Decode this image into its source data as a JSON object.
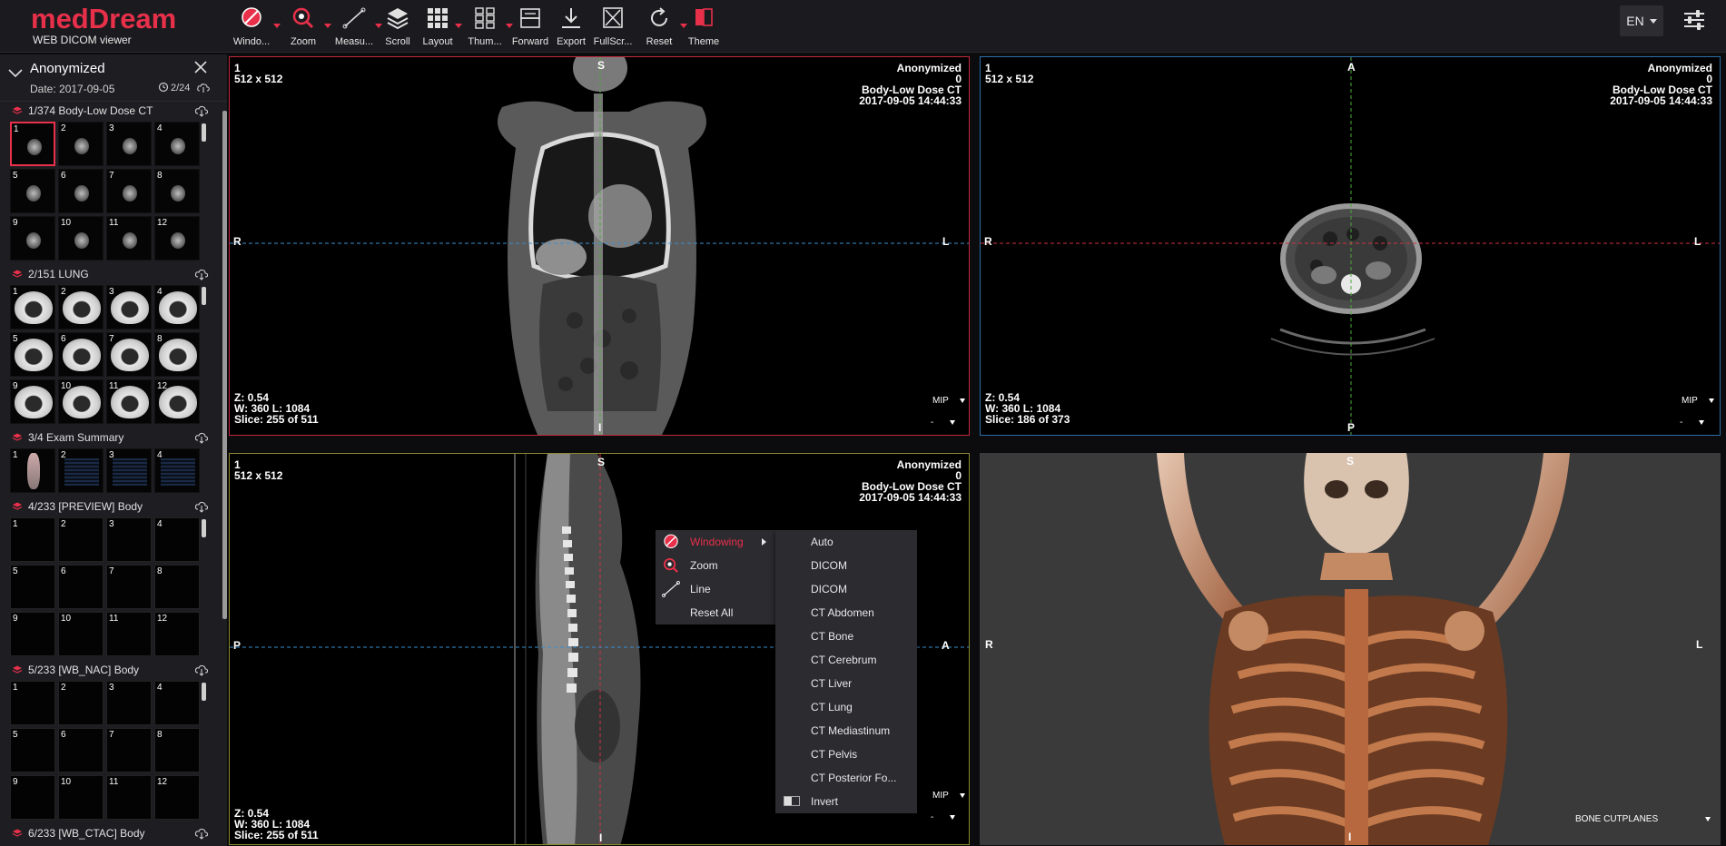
{
  "brand": {
    "logo": "medDream",
    "subtitle": "WEB DICOM viewer",
    "accent": "#e8304a"
  },
  "toolbar": [
    {
      "label": "Windo...",
      "icon": "windowing-icon",
      "caret": true
    },
    {
      "label": "Zoom",
      "icon": "zoom-icon",
      "caret": true
    },
    {
      "label": "Measu...",
      "icon": "measure-icon",
      "caret": true
    },
    {
      "label": "Scroll",
      "icon": "scroll-icon",
      "caret": false
    },
    {
      "label": "Layout",
      "icon": "layout-icon",
      "caret": true
    },
    {
      "label": "Thum...",
      "icon": "thumbnails-icon",
      "caret": true
    },
    {
      "label": "Forward",
      "icon": "forward-icon",
      "caret": false
    },
    {
      "label": "Export",
      "icon": "export-icon",
      "caret": false
    },
    {
      "label": "FullScr...",
      "icon": "fullscreen-icon",
      "caret": false
    },
    {
      "label": "Reset",
      "icon": "reset-icon",
      "caret": true
    },
    {
      "label": "Theme",
      "icon": "theme-icon",
      "caret": false
    }
  ],
  "language": "EN",
  "patient": {
    "name": "Anonymized",
    "date": "Date:  2017-09-05",
    "study_count": "2/24"
  },
  "series": [
    {
      "label": "1/374   Body-Low Dose CT",
      "kind": "ct",
      "thumbs": [
        "1",
        "2",
        "3",
        "4",
        "5",
        "6",
        "7",
        "8",
        "9",
        "10",
        "11",
        "12"
      ]
    },
    {
      "label": "2/151   LUNG",
      "kind": "lung",
      "thumbs": [
        "1",
        "2",
        "3",
        "4",
        "5",
        "6",
        "7",
        "8",
        "9",
        "10",
        "11",
        "12"
      ]
    },
    {
      "label": "3/4   Exam Summary",
      "kind": "summary",
      "thumbs": [
        "1",
        "2",
        "3",
        "4"
      ]
    },
    {
      "label": "4/233   [PREVIEW] Body",
      "kind": "dark",
      "thumbs": [
        "1",
        "2",
        "3",
        "4",
        "5",
        "6",
        "7",
        "8",
        "9",
        "10",
        "11",
        "12"
      ]
    },
    {
      "label": "5/233   [WB_NAC] Body",
      "kind": "dark",
      "thumbs": [
        "1",
        "2",
        "3",
        "4",
        "5",
        "6",
        "7",
        "8",
        "9",
        "10",
        "11",
        "12"
      ]
    },
    {
      "label": "6/233   [WB_CTAC] Body",
      "kind": "dark",
      "thumbs": []
    }
  ],
  "viewports": {
    "coronal": {
      "tl_index": "1",
      "tl_size": "512 x 512",
      "tr_name": "Anonymized",
      "tr_num": "0",
      "tr_series": "Body-Low Dose CT",
      "tr_date": "2017-09-05 14:44:33",
      "zoom": "Z: 0.54",
      "wl": "W: 360 L: 1084",
      "slice": "Slice: 255 of 511",
      "mip": "MIP",
      "mip2": "-",
      "left": "R",
      "right": "L",
      "top": "S",
      "bottom": "I"
    },
    "axial": {
      "tl_index": "1",
      "tl_size": "512 x 512",
      "tr_name": "Anonymized",
      "tr_num": "0",
      "tr_series": "Body-Low Dose CT",
      "tr_date": "2017-09-05 14:44:33",
      "zoom": "Z: 0.54",
      "wl": "W: 360 L: 1084",
      "slice": "Slice: 186 of 373",
      "mip": "MIP",
      "mip2": "-",
      "left": "R",
      "right": "L",
      "top": "A",
      "bottom": "P"
    },
    "sagittal": {
      "tl_index": "1",
      "tl_size": "512 x 512",
      "tr_name": "Anonymized",
      "tr_num": "0",
      "tr_series": "Body-Low Dose CT",
      "tr_date": "2017-09-05 14:44:33",
      "zoom": "Z: 0.54",
      "wl": "W: 360 L: 1084",
      "slice": "Slice: 255 of 511",
      "mip": "MIP",
      "mip2": "-",
      "left": "P",
      "right": "A",
      "top": "S",
      "bottom": "I"
    },
    "volume": {
      "left": "R",
      "right": "L",
      "top": "S",
      "bottom": "I",
      "mode": "BONE CUTPLANES"
    }
  },
  "context_menu": [
    {
      "label": "Windowing",
      "icon": "windowing-icon",
      "active": true,
      "submenu": true
    },
    {
      "label": "Zoom",
      "icon": "zoom-icon",
      "active": false,
      "submenu": false
    },
    {
      "label": "Line",
      "icon": "line-icon",
      "active": false,
      "submenu": false
    },
    {
      "label": "Reset All",
      "icon": "",
      "active": false,
      "submenu": false
    }
  ],
  "windowing_presets": [
    "Auto",
    "DICOM",
    "DICOM",
    "CT Abdomen",
    "CT Bone",
    "CT Cerebrum",
    "CT Liver",
    "CT Lung",
    "CT Mediastinum",
    "CT Pelvis",
    "CT Posterior Fo...",
    "Invert"
  ]
}
